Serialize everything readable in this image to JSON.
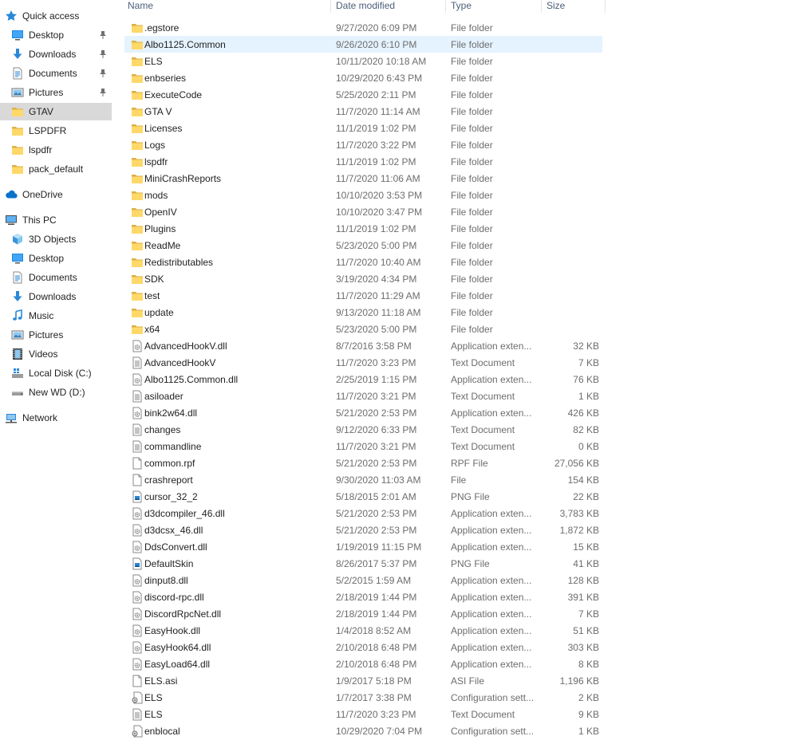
{
  "sidebar": {
    "items": [
      {
        "label": "Quick access",
        "icon": "star-icon",
        "name": "nav-quick-access",
        "indent": 0,
        "pinned": false
      },
      {
        "label": "Desktop",
        "icon": "desktop-icon",
        "name": "nav-desktop",
        "indent": 1,
        "pinned": true
      },
      {
        "label": "Downloads",
        "icon": "download-icon",
        "name": "nav-downloads",
        "indent": 1,
        "pinned": true
      },
      {
        "label": "Documents",
        "icon": "document-icon",
        "name": "nav-documents",
        "indent": 1,
        "pinned": true
      },
      {
        "label": "Pictures",
        "icon": "pictures-icon",
        "name": "nav-pictures",
        "indent": 1,
        "pinned": true
      },
      {
        "label": "GTAV",
        "icon": "folder-icon",
        "name": "nav-gtav",
        "indent": 1,
        "pinned": false,
        "selected": true
      },
      {
        "label": "LSPDFR",
        "icon": "folder-icon",
        "name": "nav-lspdfr",
        "indent": 1,
        "pinned": false
      },
      {
        "label": "lspdfr",
        "icon": "folder-icon",
        "name": "nav-lspdfr-lower",
        "indent": 1,
        "pinned": false
      },
      {
        "label": "pack_default",
        "icon": "folder-icon",
        "name": "nav-pack-default",
        "indent": 1,
        "pinned": false
      },
      {
        "label": "OneDrive",
        "icon": "cloud-icon",
        "name": "nav-onedrive",
        "indent": 0,
        "pinned": false
      },
      {
        "label": "This PC",
        "icon": "computer-icon",
        "name": "nav-this-pc",
        "indent": 0,
        "pinned": false
      },
      {
        "label": "3D Objects",
        "icon": "cube-icon",
        "name": "nav-3d-objects",
        "indent": 1,
        "pinned": false
      },
      {
        "label": "Desktop",
        "icon": "desktop-icon",
        "name": "nav-pc-desktop",
        "indent": 1,
        "pinned": false
      },
      {
        "label": "Documents",
        "icon": "document-icon",
        "name": "nav-pc-documents",
        "indent": 1,
        "pinned": false
      },
      {
        "label": "Downloads",
        "icon": "download-icon",
        "name": "nav-pc-downloads",
        "indent": 1,
        "pinned": false
      },
      {
        "label": "Music",
        "icon": "music-note-icon",
        "name": "nav-music",
        "indent": 1,
        "pinned": false
      },
      {
        "label": "Pictures",
        "icon": "pictures-icon",
        "name": "nav-pc-pictures",
        "indent": 1,
        "pinned": false
      },
      {
        "label": "Videos",
        "icon": "film-icon",
        "name": "nav-videos",
        "indent": 1,
        "pinned": false
      },
      {
        "label": "Local Disk (C:)",
        "icon": "windows-drive-icon",
        "name": "nav-local-disk-c",
        "indent": 1,
        "pinned": false
      },
      {
        "label": "New WD (D:)",
        "icon": "drive-icon",
        "name": "nav-new-wd-d",
        "indent": 1,
        "pinned": false
      },
      {
        "label": "Network",
        "icon": "network-icon",
        "name": "nav-network",
        "indent": 0,
        "pinned": false
      }
    ]
  },
  "columns": {
    "name": "Name",
    "date": "Date modified",
    "type": "Type",
    "size": "Size"
  },
  "files": [
    {
      "name": ".egstore",
      "date": "9/27/2020 6:09 PM",
      "type": "File folder",
      "size": "",
      "icon": "folder-icon"
    },
    {
      "name": "Albo1125.Common",
      "date": "9/26/2020 6:10 PM",
      "type": "File folder",
      "size": "",
      "icon": "folder-icon",
      "hover": true
    },
    {
      "name": "ELS",
      "date": "10/11/2020 10:18 AM",
      "type": "File folder",
      "size": "",
      "icon": "folder-icon"
    },
    {
      "name": "enbseries",
      "date": "10/29/2020 6:43 PM",
      "type": "File folder",
      "size": "",
      "icon": "folder-icon"
    },
    {
      "name": "ExecuteCode",
      "date": "5/25/2020 2:11 PM",
      "type": "File folder",
      "size": "",
      "icon": "folder-icon"
    },
    {
      "name": "GTA V",
      "date": "11/7/2020 11:14 AM",
      "type": "File folder",
      "size": "",
      "icon": "folder-icon"
    },
    {
      "name": "Licenses",
      "date": "11/1/2019 1:02 PM",
      "type": "File folder",
      "size": "",
      "icon": "folder-icon"
    },
    {
      "name": "Logs",
      "date": "11/7/2020 3:22 PM",
      "type": "File folder",
      "size": "",
      "icon": "folder-icon"
    },
    {
      "name": "lspdfr",
      "date": "11/1/2019 1:02 PM",
      "type": "File folder",
      "size": "",
      "icon": "folder-icon"
    },
    {
      "name": "MiniCrashReports",
      "date": "11/7/2020 11:06 AM",
      "type": "File folder",
      "size": "",
      "icon": "folder-icon"
    },
    {
      "name": "mods",
      "date": "10/10/2020 3:53 PM",
      "type": "File folder",
      "size": "",
      "icon": "folder-icon"
    },
    {
      "name": "OpenIV",
      "date": "10/10/2020 3:47 PM",
      "type": "File folder",
      "size": "",
      "icon": "folder-icon"
    },
    {
      "name": "Plugins",
      "date": "11/1/2019 1:02 PM",
      "type": "File folder",
      "size": "",
      "icon": "folder-icon"
    },
    {
      "name": "ReadMe",
      "date": "5/23/2020 5:00 PM",
      "type": "File folder",
      "size": "",
      "icon": "folder-icon"
    },
    {
      "name": "Redistributables",
      "date": "11/7/2020 10:40 AM",
      "type": "File folder",
      "size": "",
      "icon": "folder-icon"
    },
    {
      "name": "SDK",
      "date": "3/19/2020 4:34 PM",
      "type": "File folder",
      "size": "",
      "icon": "folder-icon"
    },
    {
      "name": "test",
      "date": "11/7/2020 11:29 AM",
      "type": "File folder",
      "size": "",
      "icon": "folder-icon"
    },
    {
      "name": "update",
      "date": "9/13/2020 11:18 AM",
      "type": "File folder",
      "size": "",
      "icon": "folder-icon"
    },
    {
      "name": "x64",
      "date": "5/23/2020 5:00 PM",
      "type": "File folder",
      "size": "",
      "icon": "folder-icon"
    },
    {
      "name": "AdvancedHookV.dll",
      "date": "8/7/2016 3:58 PM",
      "type": "Application exten...",
      "size": "32 KB",
      "icon": "dll-icon"
    },
    {
      "name": "AdvancedHookV",
      "date": "11/7/2020 3:23 PM",
      "type": "Text Document",
      "size": "7 KB",
      "icon": "text-file-icon"
    },
    {
      "name": "Albo1125.Common.dll",
      "date": "2/25/2019 1:15 PM",
      "type": "Application exten...",
      "size": "76 KB",
      "icon": "dll-icon"
    },
    {
      "name": "asiloader",
      "date": "11/7/2020 3:21 PM",
      "type": "Text Document",
      "size": "1 KB",
      "icon": "text-file-icon"
    },
    {
      "name": "bink2w64.dll",
      "date": "5/21/2020 2:53 PM",
      "type": "Application exten...",
      "size": "426 KB",
      "icon": "dll-icon"
    },
    {
      "name": "changes",
      "date": "9/12/2020 6:33 PM",
      "type": "Text Document",
      "size": "82 KB",
      "icon": "text-file-icon"
    },
    {
      "name": "commandline",
      "date": "11/7/2020 3:21 PM",
      "type": "Text Document",
      "size": "0 KB",
      "icon": "text-file-icon"
    },
    {
      "name": "common.rpf",
      "date": "5/21/2020 2:53 PM",
      "type": "RPF File",
      "size": "27,056 KB",
      "icon": "blank-file-icon"
    },
    {
      "name": "crashreport",
      "date": "9/30/2020 11:03 AM",
      "type": "File",
      "size": "154 KB",
      "icon": "blank-file-icon"
    },
    {
      "name": "cursor_32_2",
      "date": "5/18/2015 2:01 AM",
      "type": "PNG File",
      "size": "22 KB",
      "icon": "image-file-icon"
    },
    {
      "name": "d3dcompiler_46.dll",
      "date": "5/21/2020 2:53 PM",
      "type": "Application exten...",
      "size": "3,783 KB",
      "icon": "dll-icon"
    },
    {
      "name": "d3dcsx_46.dll",
      "date": "5/21/2020 2:53 PM",
      "type": "Application exten...",
      "size": "1,872 KB",
      "icon": "dll-icon"
    },
    {
      "name": "DdsConvert.dll",
      "date": "1/19/2019 11:15 PM",
      "type": "Application exten...",
      "size": "15 KB",
      "icon": "dll-icon"
    },
    {
      "name": "DefaultSkin",
      "date": "8/26/2017 5:37 PM",
      "type": "PNG File",
      "size": "41 KB",
      "icon": "image-file-icon"
    },
    {
      "name": "dinput8.dll",
      "date": "5/2/2015 1:59 AM",
      "type": "Application exten...",
      "size": "128 KB",
      "icon": "dll-icon"
    },
    {
      "name": "discord-rpc.dll",
      "date": "2/18/2019 1:44 PM",
      "type": "Application exten...",
      "size": "391 KB",
      "icon": "dll-icon"
    },
    {
      "name": "DiscordRpcNet.dll",
      "date": "2/18/2019 1:44 PM",
      "type": "Application exten...",
      "size": "7 KB",
      "icon": "dll-icon"
    },
    {
      "name": "EasyHook.dll",
      "date": "1/4/2018 8:52 AM",
      "type": "Application exten...",
      "size": "51 KB",
      "icon": "dll-icon"
    },
    {
      "name": "EasyHook64.dll",
      "date": "2/10/2018 6:48 PM",
      "type": "Application exten...",
      "size": "303 KB",
      "icon": "dll-icon"
    },
    {
      "name": "EasyLoad64.dll",
      "date": "2/10/2018 6:48 PM",
      "type": "Application exten...",
      "size": "8 KB",
      "icon": "dll-icon"
    },
    {
      "name": "ELS.asi",
      "date": "1/9/2017 5:18 PM",
      "type": "ASI File",
      "size": "1,196 KB",
      "icon": "blank-file-icon"
    },
    {
      "name": "ELS",
      "date": "1/7/2017 3:38 PM",
      "type": "Configuration sett...",
      "size": "2 KB",
      "icon": "config-file-icon"
    },
    {
      "name": "ELS",
      "date": "11/7/2020 3:23 PM",
      "type": "Text Document",
      "size": "9 KB",
      "icon": "text-file-icon"
    },
    {
      "name": "enblocal",
      "date": "10/29/2020 7:04 PM",
      "type": "Configuration sett...",
      "size": "1 KB",
      "icon": "config-file-icon"
    }
  ]
}
